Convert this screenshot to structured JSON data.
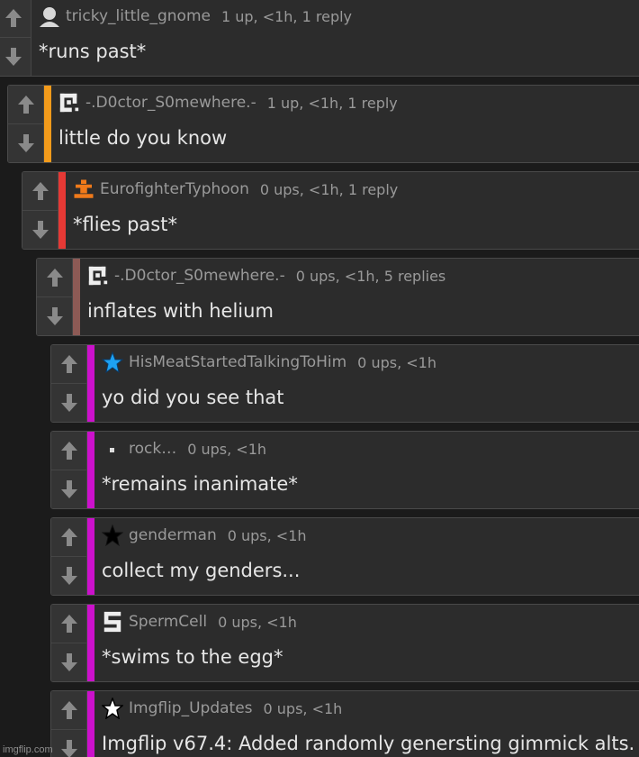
{
  "comments": [
    {
      "username": "tricky_little_gnome",
      "meta": "1 up, <1h, 1 reply",
      "text": "*runs past*",
      "avatar": "person-icon",
      "bar_color": ""
    },
    {
      "username": "-.D0ctor_S0mewhere.-",
      "meta": "1 up, <1h, 1 reply",
      "text": "little do you know",
      "avatar": "pixel-logo-icon",
      "bar_color": "#f39b1b"
    },
    {
      "username": "EurofighterTyphoon",
      "meta": "0 ups, <1h, 1 reply",
      "text": "*flies past*",
      "avatar": "chess-piece-icon",
      "bar_color": "#e53935"
    },
    {
      "username": "-.D0ctor_S0mewhere.-",
      "meta": "0 ups, <1h, 5 replies",
      "text": "inflates with helium",
      "avatar": "pixel-logo-icon",
      "bar_color": "#8d5a55"
    },
    {
      "username": "HisMeatStartedTalkingToHim",
      "meta": "0 ups, <1h",
      "text": "yo did you see that",
      "avatar": "blue-star-icon",
      "bar_color": "#cc11cc"
    },
    {
      "username": "rock…",
      "meta": "0 ups, <1h",
      "text": "*remains inanimate*",
      "avatar": "small-square-icon",
      "bar_color": "#cc11cc"
    },
    {
      "username": "genderman",
      "meta": "0 ups, <1h",
      "text": "collect my genders...",
      "avatar": "black-star-icon",
      "bar_color": "#cc11cc"
    },
    {
      "username": "SpermCell",
      "meta": "0 ups, <1h",
      "text": "*swims to the egg*",
      "avatar": "s-logo-icon",
      "bar_color": "#cc11cc"
    },
    {
      "username": "Imgflip_Updates",
      "meta": "0 ups, <1h",
      "text": "Imgflip v67.4: Added randomly genersting gimmick alts.",
      "avatar": "white-star-icon",
      "bar_color": "#cc11cc"
    }
  ],
  "watermark": "imgflip.com",
  "colors": {
    "background": "#1b1b1b",
    "card": "#2c2c2c",
    "username": "#9a9a9a",
    "text": "#e6e6e6"
  }
}
